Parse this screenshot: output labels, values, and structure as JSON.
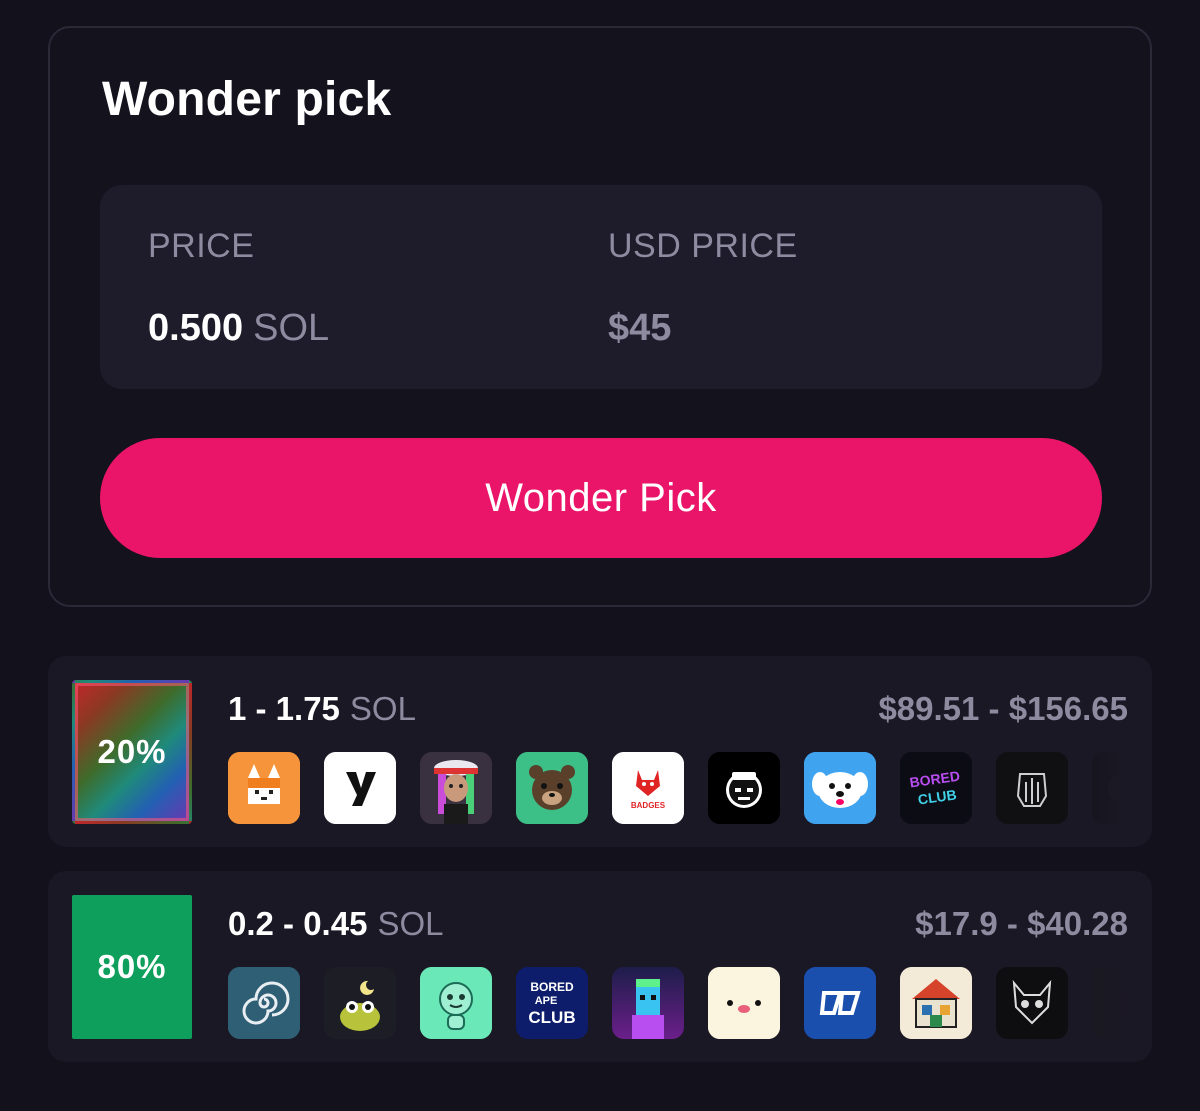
{
  "card": {
    "title": "Wonder pick",
    "price_label": "PRICE",
    "price_value": "0.500",
    "price_unit": "SOL",
    "usd_label": "USD PRICE",
    "usd_value": "$45",
    "button_label": "Wonder Pick"
  },
  "tiers": [
    {
      "odds": "20%",
      "range": "1 - 1.75",
      "unit": "SOL",
      "usd_range": "$89.51 - $156.65",
      "swatch": "rainbow",
      "collections": [
        "shiba-icon",
        "y-logo-icon",
        "avatar-girl-icon",
        "bear-icon",
        "badges-icon",
        "ape-icon",
        "dog-icon",
        "bored-club-icon",
        "skull-art-icon",
        "partial-icon"
      ]
    },
    {
      "odds": "80%",
      "range": "0.2 - 0.45",
      "unit": "SOL",
      "usd_range": "$17.9 - $40.28",
      "swatch": "#0f9f5c",
      "collections": [
        "spiral-icon",
        "frog-icon",
        "alien-icon",
        "bored-ape-club-icon",
        "punk-icon",
        "blob-face-icon",
        "zz-logo-icon",
        "pixel-house-icon",
        "cat-skull-icon",
        "partial-icon"
      ]
    }
  ],
  "thumb_texts": {
    "badges": "BADGES",
    "bored_ape_club": [
      "BORED",
      "APE",
      "CLUB"
    ],
    "bored_club": [
      "BORED",
      "CLUB"
    ]
  },
  "colors": {
    "background": "#13111c",
    "accent": "#ea1469",
    "muted_text": "#8e8a9f",
    "panel": "#1e1b2b"
  }
}
